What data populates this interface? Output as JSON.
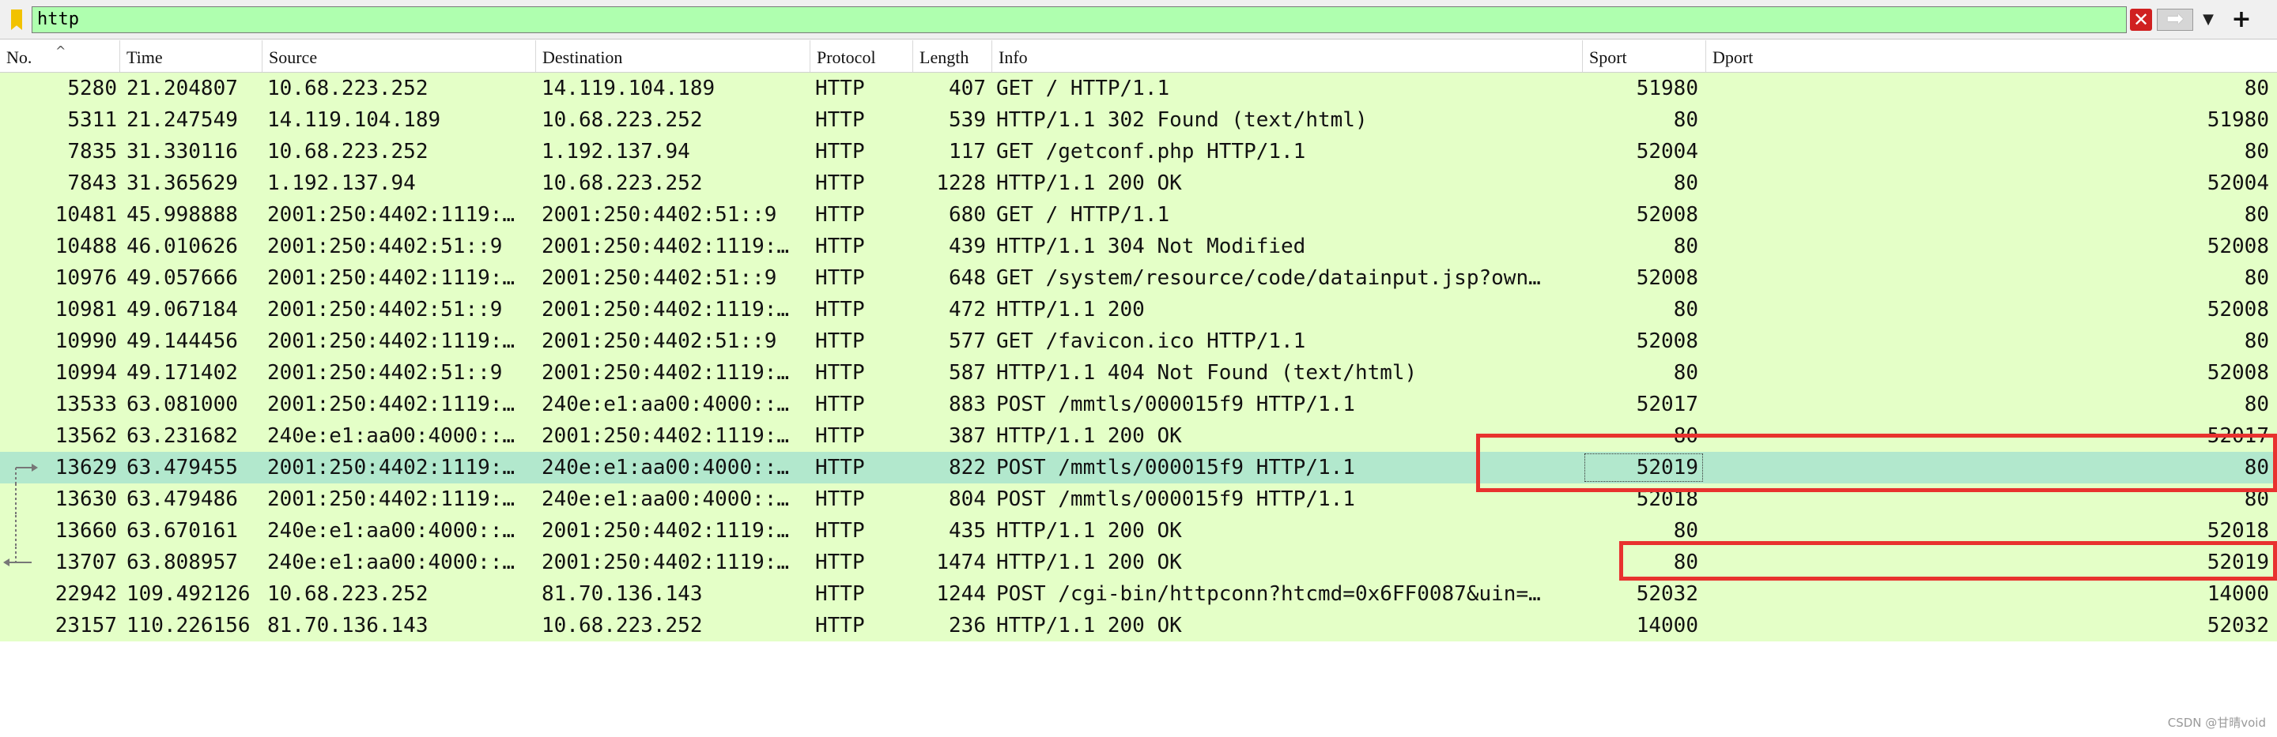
{
  "filter": {
    "value": "http",
    "bookmark_icon": "bookmark-icon",
    "clear_icon": "clear-x-icon",
    "clear_glyph": "✕",
    "apply_icon": "arrow-right-icon",
    "apply_glyph": "➡",
    "dropdown_icon": "chevron-down-icon",
    "dropdown_glyph": "▼",
    "add_icon": "plus-icon",
    "add_glyph": "+"
  },
  "columns": {
    "no": "No.",
    "time": "Time",
    "source": "Source",
    "destination": "Destination",
    "protocol": "Protocol",
    "length": "Length",
    "info": "Info",
    "sport": "Sport",
    "dport": "Dport",
    "sort_glyph": "^"
  },
  "packets": [
    {
      "no": "5280",
      "time": "21.204807",
      "source": "10.68.223.252",
      "destination": "14.119.104.189",
      "protocol": "HTTP",
      "length": "407",
      "info": "GET / HTTP/1.1",
      "sport": "51980",
      "dport": "80"
    },
    {
      "no": "5311",
      "time": "21.247549",
      "source": "14.119.104.189",
      "destination": "10.68.223.252",
      "protocol": "HTTP",
      "length": "539",
      "info": "HTTP/1.1 302 Found  (text/html)",
      "sport": "80",
      "dport": "51980"
    },
    {
      "no": "7835",
      "time": "31.330116",
      "source": "10.68.223.252",
      "destination": "1.192.137.94",
      "protocol": "HTTP",
      "length": "117",
      "info": "GET /getconf.php HTTP/1.1",
      "sport": "52004",
      "dport": "80"
    },
    {
      "no": "7843",
      "time": "31.365629",
      "source": "1.192.137.94",
      "destination": "10.68.223.252",
      "protocol": "HTTP",
      "length": "1228",
      "info": "HTTP/1.1 200 OK",
      "sport": "80",
      "dport": "52004"
    },
    {
      "no": "10481",
      "time": "45.998888",
      "source": "2001:250:4402:1119:…",
      "destination": "2001:250:4402:51::9",
      "protocol": "HTTP",
      "length": "680",
      "info": "GET / HTTP/1.1",
      "sport": "52008",
      "dport": "80"
    },
    {
      "no": "10488",
      "time": "46.010626",
      "source": "2001:250:4402:51::9",
      "destination": "2001:250:4402:1119:…",
      "protocol": "HTTP",
      "length": "439",
      "info": "HTTP/1.1 304 Not Modified",
      "sport": "80",
      "dport": "52008"
    },
    {
      "no": "10976",
      "time": "49.057666",
      "source": "2001:250:4402:1119:…",
      "destination": "2001:250:4402:51::9",
      "protocol": "HTTP",
      "length": "648",
      "info": "GET /system/resource/code/datainput.jsp?own…",
      "sport": "52008",
      "dport": "80"
    },
    {
      "no": "10981",
      "time": "49.067184",
      "source": "2001:250:4402:51::9",
      "destination": "2001:250:4402:1119:…",
      "protocol": "HTTP",
      "length": "472",
      "info": "HTTP/1.1 200",
      "sport": "80",
      "dport": "52008"
    },
    {
      "no": "10990",
      "time": "49.144456",
      "source": "2001:250:4402:1119:…",
      "destination": "2001:250:4402:51::9",
      "protocol": "HTTP",
      "length": "577",
      "info": "GET /favicon.ico HTTP/1.1",
      "sport": "52008",
      "dport": "80"
    },
    {
      "no": "10994",
      "time": "49.171402",
      "source": "2001:250:4402:51::9",
      "destination": "2001:250:4402:1119:…",
      "protocol": "HTTP",
      "length": "587",
      "info": "HTTP/1.1 404 Not Found  (text/html)",
      "sport": "80",
      "dport": "52008"
    },
    {
      "no": "13533",
      "time": "63.081000",
      "source": "2001:250:4402:1119:…",
      "destination": "240e:e1:aa00:4000::…",
      "protocol": "HTTP",
      "length": "883",
      "info": "POST /mmtls/000015f9 HTTP/1.1",
      "sport": "52017",
      "dport": "80"
    },
    {
      "no": "13562",
      "time": "63.231682",
      "source": "240e:e1:aa00:4000::…",
      "destination": "2001:250:4402:1119:…",
      "protocol": "HTTP",
      "length": "387",
      "info": "HTTP/1.1 200 OK",
      "sport": "80",
      "dport": "52017"
    },
    {
      "no": "13629",
      "time": "63.479455",
      "source": "2001:250:4402:1119:…",
      "destination": "240e:e1:aa00:4000::…",
      "protocol": "HTTP",
      "length": "822",
      "info": "POST /mmtls/000015f9 HTTP/1.1",
      "sport": "52019",
      "dport": "80"
    },
    {
      "no": "13630",
      "time": "63.479486",
      "source": "2001:250:4402:1119:…",
      "destination": "240e:e1:aa00:4000::…",
      "protocol": "HTTP",
      "length": "804",
      "info": "POST /mmtls/000015f9 HTTP/1.1",
      "sport": "52018",
      "dport": "80"
    },
    {
      "no": "13660",
      "time": "63.670161",
      "source": "240e:e1:aa00:4000::…",
      "destination": "2001:250:4402:1119:…",
      "protocol": "HTTP",
      "length": "435",
      "info": "HTTP/1.1 200 OK",
      "sport": "80",
      "dport": "52018"
    },
    {
      "no": "13707",
      "time": "63.808957",
      "source": "240e:e1:aa00:4000::…",
      "destination": "2001:250:4402:1119:…",
      "protocol": "HTTP",
      "length": "1474",
      "info": "HTTP/1.1 200 OK",
      "sport": "80",
      "dport": "52019"
    },
    {
      "no": "22942",
      "time": "109.492126",
      "source": "10.68.223.252",
      "destination": "81.70.136.143",
      "protocol": "HTTP",
      "length": "1244",
      "info": "POST /cgi-bin/httpconn?htcmd=0x6FF0087&uin=…",
      "sport": "52032",
      "dport": "14000"
    },
    {
      "no": "23157",
      "time": "110.226156",
      "source": "81.70.136.143",
      "destination": "10.68.223.252",
      "protocol": "HTTP",
      "length": "236",
      "info": "HTTP/1.1 200 OK",
      "sport": "14000",
      "dport": "52032"
    }
  ],
  "selected_row": 12,
  "colors": {
    "row_bg": "#e4ffc7",
    "selected_bg": "#b2e8cd",
    "filter_valid_bg": "#afffaf",
    "annotation_red": "#e8322e"
  },
  "watermark": "CSDN @甘晴void"
}
